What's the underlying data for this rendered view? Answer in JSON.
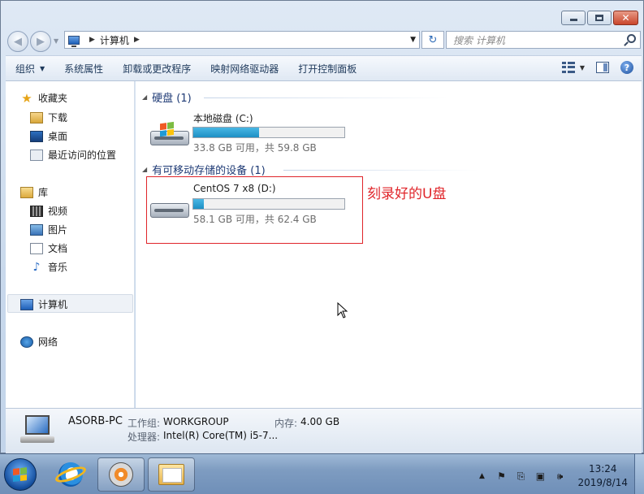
{
  "window": {
    "controls": {
      "minimize": "minimize",
      "maximize": "maximize",
      "close": "close"
    }
  },
  "address": {
    "path": [
      "计算机"
    ],
    "search_placeholder": "搜索 计算机"
  },
  "toolbar": {
    "items": [
      "组织",
      "系统属性",
      "卸载或更改程序",
      "映射网络驱动器",
      "打开控制面板"
    ]
  },
  "nav": {
    "favorites": {
      "label": "收藏夹",
      "items": [
        "下载",
        "桌面",
        "最近访问的位置"
      ]
    },
    "libraries": {
      "label": "库",
      "items": [
        "视频",
        "图片",
        "文档",
        "音乐"
      ]
    },
    "computer": "计算机",
    "network": "网络"
  },
  "content": {
    "hdd_group": "硬盘 (1)",
    "removable_group": "有可移动存储的设备 (1)",
    "drives": [
      {
        "name": "本地磁盘 (C:)",
        "info": "33.8 GB 可用，共 59.8 GB",
        "used_fraction": 0.435
      },
      {
        "name": "CentOS 7 x8 (D:)",
        "info": "58.1 GB 可用，共 62.4 GB",
        "used_fraction": 0.069
      }
    ],
    "annotation": "刻录好的U盘",
    "annotation_color": "#e0252a"
  },
  "details": {
    "pc_name": "ASORB-PC",
    "workgroup_label": "工作组:",
    "workgroup_value": "WORKGROUP",
    "memory_label": "内存:",
    "memory_value": "4.00 GB",
    "cpu_label": "处理器:",
    "cpu_value": "Intel(R) Core(TM) i5-7..."
  },
  "taskbar": {
    "time": "13:24",
    "date": "2019/8/14"
  },
  "colors": {
    "link_blue": "#1e3a75",
    "bar_fill": "#26a0da"
  }
}
